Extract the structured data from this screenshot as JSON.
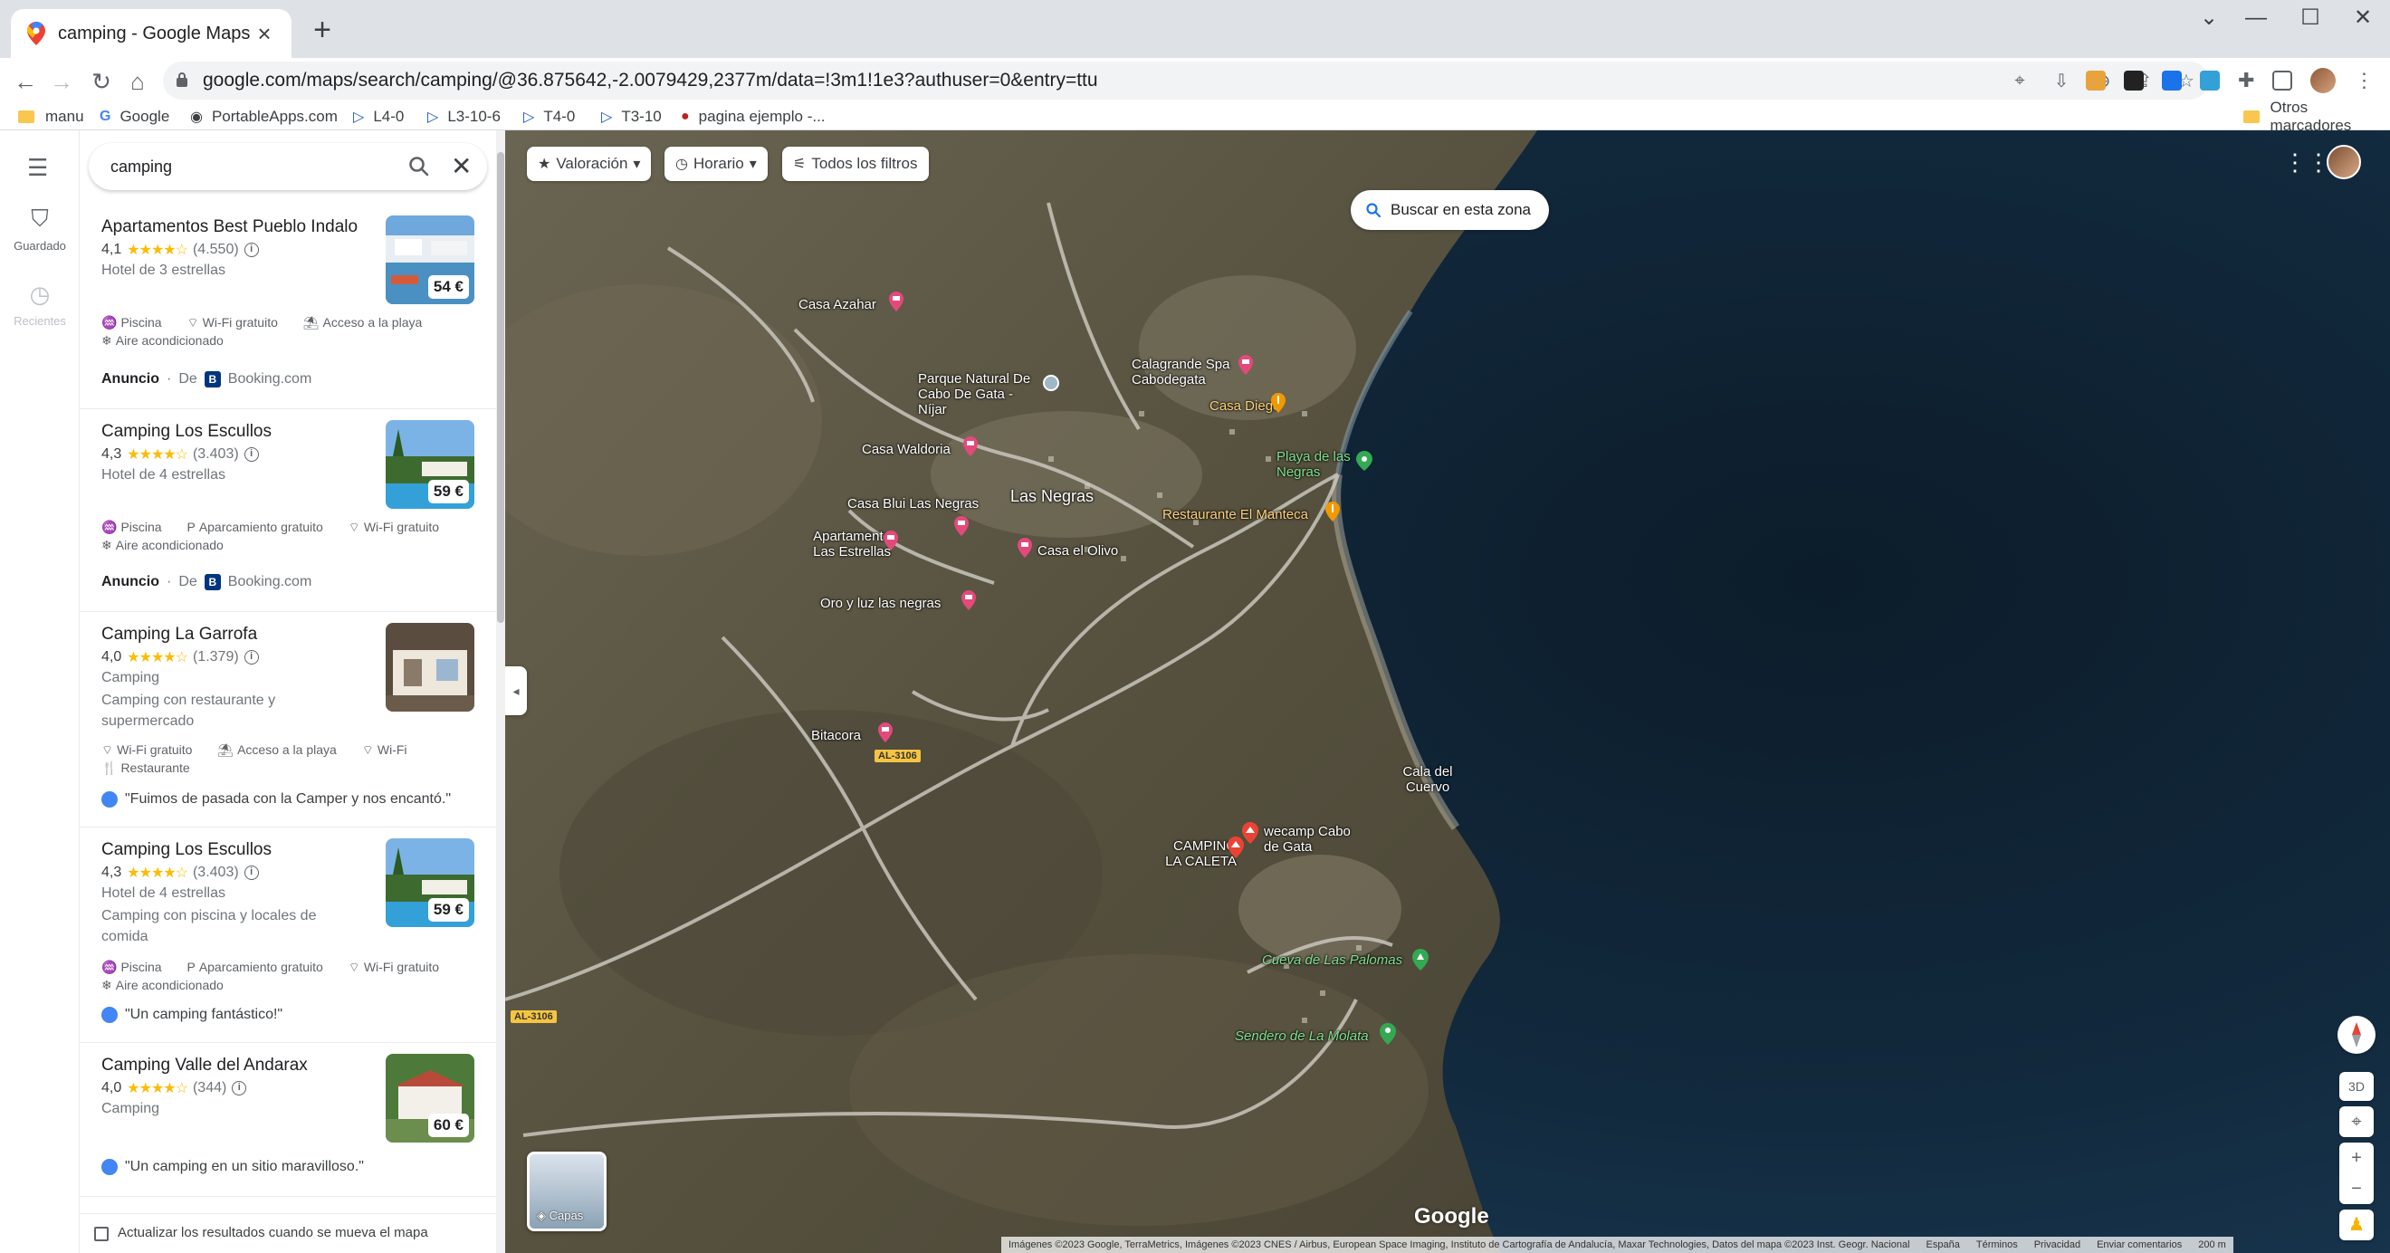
{
  "browser": {
    "tab_title": "camping - Google Maps",
    "new_tab": "+",
    "url": "google.com/maps/search/camping/@36.875642,-2.0079429,2377m/data=!3m1!1e3?authuser=0&entry=ttu",
    "bookmarks": [
      "manu",
      "Google",
      "PortableApps.com",
      "L4-0",
      "L3-10-6",
      "T4-0",
      "T3-10",
      "pagina ejemplo -..."
    ],
    "other_bookmarks": "Otros marcadores"
  },
  "rail": {
    "saved": "Guardado",
    "recent": "Recientes"
  },
  "search": {
    "value": "camping"
  },
  "results": [
    {
      "name": "Apartamentos Best Pueblo Indalo",
      "rating": "4,1",
      "stars": "★★★★☆",
      "reviews": "(4.550)",
      "type": "Hotel de 3 estrellas",
      "price": "54 €",
      "amenities": [
        "Piscina",
        "Wi-Fi gratuito",
        "Acceso a la playa",
        "Aire acondicionado"
      ],
      "ad_label": "Anuncio",
      "ad_from": "De",
      "ad_source": "Booking.com"
    },
    {
      "name": "Camping Los Escullos",
      "rating": "4,3",
      "stars": "★★★★☆",
      "reviews": "(3.403)",
      "type": "Hotel de 4 estrellas",
      "price": "59 €",
      "amenities": [
        "Piscina",
        "Aparcamiento gratuito",
        "Wi-Fi gratuito",
        "Aire acondicionado"
      ],
      "ad_label": "Anuncio",
      "ad_from": "De",
      "ad_source": "Booking.com"
    },
    {
      "name": "Camping La Garrofa",
      "rating": "4,0",
      "stars": "★★★★☆",
      "reviews": "(1.379)",
      "type": "Camping",
      "desc": "Camping con restaurante y supermercado",
      "amenities": [
        "Wi-Fi gratuito",
        "Acceso a la playa",
        "Wi-Fi",
        "Restaurante"
      ],
      "review": "\"Fuimos de pasada con la Camper y nos encantó.\""
    },
    {
      "name": "Camping Los Escullos",
      "rating": "4,3",
      "stars": "★★★★☆",
      "reviews": "(3.403)",
      "type": "Hotel de 4 estrellas",
      "desc": "Camping con piscina y locales de comida",
      "price": "59 €",
      "amenities": [
        "Piscina",
        "Aparcamiento gratuito",
        "Wi-Fi gratuito",
        "Aire acondicionado"
      ],
      "review": "\"Un camping fantástico!\""
    },
    {
      "name": "Camping Valle del Andarax",
      "rating": "4,0",
      "stars": "★★★★☆",
      "reviews": "(344)",
      "type": "Camping",
      "price": "60 €",
      "review": "\"Un camping en un sitio maravilloso.\""
    }
  ],
  "footer": {
    "update_label": "Actualizar los resultados cuando se mueva el mapa"
  },
  "map": {
    "chips": [
      "Valoración",
      "Horario",
      "Todos los filtros"
    ],
    "search_area": "Buscar en esta zona",
    "labels": {
      "casa_azahar": "Casa Azahar",
      "parque": "Parque Natural De Cabo De Gata - Níjar",
      "calagrande": "Calagrande Spa Cabodegata",
      "casa_diego": "Casa Diego",
      "casa_waldoria": "Casa Waldoria",
      "playa": "Playa de las Negras",
      "casa_blui": "Casa Blui Las Negras",
      "las_negras": "Las Negras",
      "restaurante": "Restaurante El Manteca",
      "apartamento": "Apartamento Las Estrellas",
      "casa_olivo": "Casa el Olivo",
      "oro_luz": "Oro y luz las negras",
      "bitacora": "Bitacora",
      "cala": "Cala del Cuervo",
      "wecamp": "wecamp Cabo de Gata",
      "caleta": "CAMPING LA CALETA",
      "cueva": "Cueva de Las Palomas",
      "sendero": "Sendero de La Molata"
    },
    "road_shields": [
      "AL-3106",
      "AL-3106"
    ],
    "layers": "Capas",
    "google": "Google",
    "btn_3d": "3D",
    "attribution": [
      "Imágenes ©2023 Google, TerraMetrics, Imágenes ©2023 CNES / Airbus, European Space Imaging, Instituto de Cartografía de Andalucía, Maxar Technologies, Datos del mapa ©2023 Inst. Geogr. Nacional",
      "España",
      "Términos",
      "Privacidad",
      "Enviar comentarios",
      "200 m"
    ],
    "colors": {
      "land": "#5e5a4a",
      "sea": "#0f2233",
      "road": "#c9c6bd"
    }
  }
}
